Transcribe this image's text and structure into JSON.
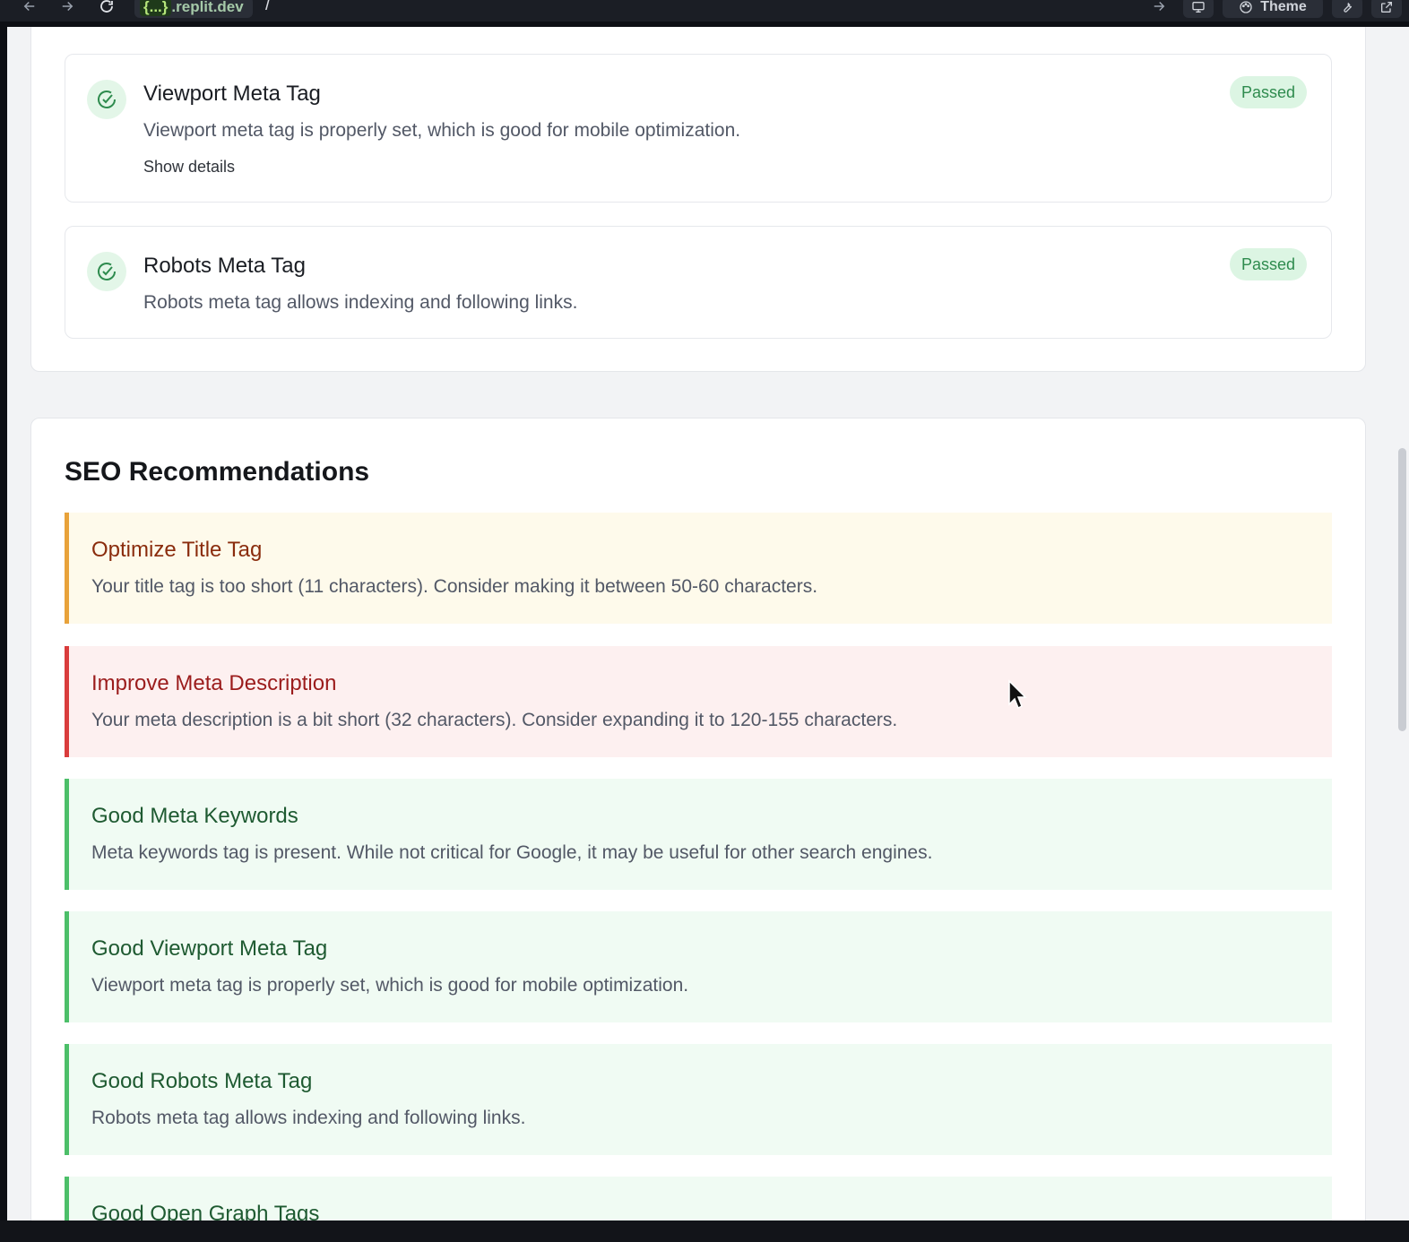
{
  "browser": {
    "url_host_prefix": "{...}",
    "url_host": ".replit.dev",
    "url_path": "/",
    "theme_label": "Theme"
  },
  "checks": [
    {
      "title": "Viewport Meta Tag",
      "description": "Viewport meta tag is properly set, which is good for mobile optimization.",
      "details_link": "Show details",
      "status": "Passed"
    },
    {
      "title": "Robots Meta Tag",
      "description": "Robots meta tag allows indexing and following links.",
      "status": "Passed"
    }
  ],
  "recommendations": {
    "heading": "SEO Recommendations",
    "items": [
      {
        "kind": "warning",
        "title": "Optimize Title Tag",
        "description": "Your title tag is too short (11 characters). Consider making it between 50-60 characters."
      },
      {
        "kind": "error",
        "title": "Improve Meta Description",
        "description": "Your meta description is a bit short (32 characters). Consider expanding it to 120-155 characters."
      },
      {
        "kind": "good",
        "title": "Good Meta Keywords",
        "description": "Meta keywords tag is present. While not critical for Google, it may be useful for other search engines."
      },
      {
        "kind": "good",
        "title": "Good Viewport Meta Tag",
        "description": "Viewport meta tag is properly set, which is good for mobile optimization."
      },
      {
        "kind": "good",
        "title": "Good Robots Meta Tag",
        "description": "Robots meta tag allows indexing and following links."
      },
      {
        "kind": "good",
        "title": "Good Open Graph Tags"
      }
    ]
  },
  "colors": {
    "passed_badge_bg": "#dcf5e3",
    "passed_badge_text": "#2e8b4e",
    "warning_border": "#e8a23a",
    "error_border": "#d93c3c",
    "good_border": "#4cbf69"
  }
}
